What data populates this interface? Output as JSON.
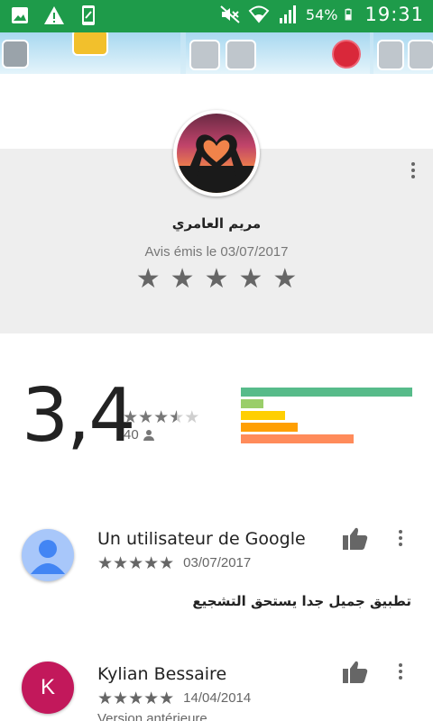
{
  "status_bar": {
    "battery_percent": "54%",
    "time": "19:31",
    "icons": [
      "gallery-icon",
      "warning-icon",
      "screenshot-icon",
      "mute-icon",
      "wifi-icon",
      "signal-icon",
      "battery-icon"
    ]
  },
  "featured_review": {
    "reviewer_name": "مريم العامري",
    "date_line": "Avis émis le 03/07/2017",
    "stars": 5
  },
  "rating_summary": {
    "average": "3,4",
    "stars_filled": 3.5,
    "count": "40",
    "distribution_colors": [
      "#57bb8a",
      "#9ace6a",
      "#ffcf02",
      "#ff9f02",
      "#ff8b5a"
    ],
    "distribution_fraction": [
      1.0,
      0.13,
      0.26,
      0.33,
      0.66
    ]
  },
  "reviews": [
    {
      "name": "Un utilisateur de Google",
      "stars": 5,
      "date": "03/07/2017",
      "body": "تطبيق جميل جدا يستحق التشجيع",
      "avatar": "default-user-avatar"
    },
    {
      "name": "Kylian Bessaire",
      "stars": 5,
      "date": "14/04/2014",
      "subtext": "Version antérieure",
      "avatar_letter": "K",
      "avatar_color": "#c2185b"
    }
  ],
  "colors": {
    "status_bar": "#1e9b4a",
    "grey_band": "#eeeeee",
    "star": "#666666"
  }
}
